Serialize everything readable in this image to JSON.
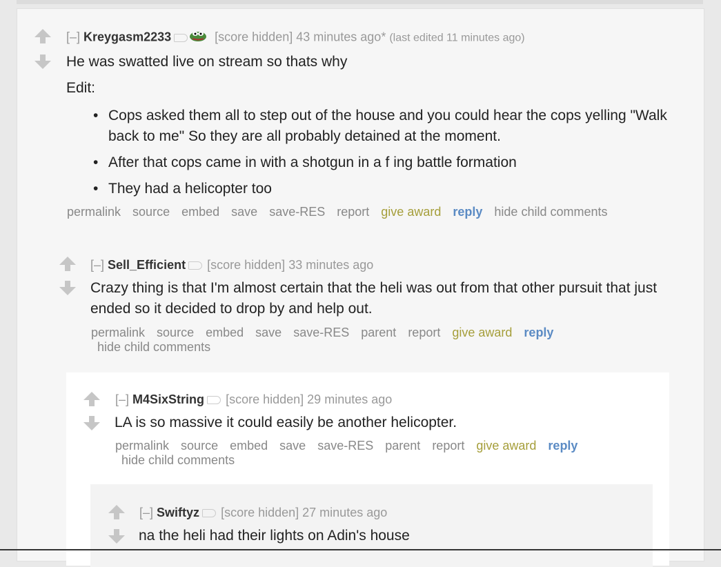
{
  "comments": [
    {
      "expand": "[–]",
      "author": "Kreygasm2233",
      "score": "[score hidden]",
      "time": "43 minutes ago*",
      "edited": "(last edited 11 minutes ago)",
      "body": [
        "He was swatted live on stream so thats why",
        "Edit:"
      ],
      "bullets": [
        "Cops asked them all to step out of the house and you could hear the cops yelling \"Walk back to me\" So they are all probably detained at the moment.",
        "After that cops came in with a shotgun in a f      ing battle formation",
        "They had a helicopter too"
      ],
      "buttons": {
        "permalink": "permalink",
        "source": "source",
        "embed": "embed",
        "save": "save",
        "save_res": "save-RES",
        "report": "report",
        "give_award": "give award",
        "reply": "reply",
        "hide_child": "hide child comments"
      }
    },
    {
      "expand": "[–]",
      "author": "Sell_Efficient",
      "score": "[score hidden]",
      "time": "33 minutes ago",
      "body": "Crazy thing is that I'm almost certain that the heli was out from that other pursuit that just ended so it decided to drop by and help out.",
      "buttons": {
        "permalink": "permalink",
        "source": "source",
        "embed": "embed",
        "save": "save",
        "save_res": "save-RES",
        "parent": "parent",
        "report": "report",
        "give_award": "give award",
        "reply": "reply",
        "hide_child": "hide child comments"
      }
    },
    {
      "expand": "[–]",
      "author": "M4SixString",
      "score": "[score hidden]",
      "time": "29 minutes ago",
      "body": "LA is so massive it could easily be another helicopter.",
      "buttons": {
        "permalink": "permalink",
        "source": "source",
        "embed": "embed",
        "save": "save",
        "save_res": "save-RES",
        "parent": "parent",
        "report": "report",
        "give_award": "give award",
        "reply": "reply",
        "hide_child": "hide child comments"
      }
    },
    {
      "expand": "[–]",
      "author": "Swiftyz",
      "score": "[score hidden]",
      "time": "27 minutes ago",
      "body": "na the heli had their lights on Adin's house"
    }
  ],
  "colors": {
    "award": "#a59e3a",
    "reply": "#5b8bc4",
    "arrow": "#c6c6c6"
  }
}
